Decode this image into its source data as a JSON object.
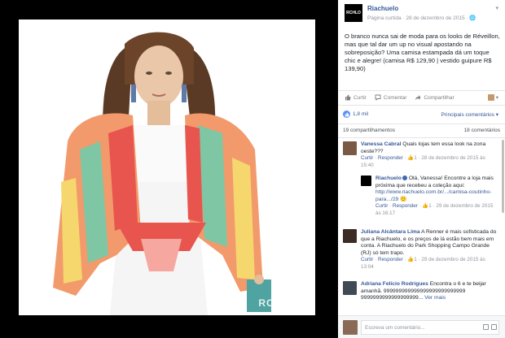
{
  "photo": {
    "watermark": "RCHLO"
  },
  "post": {
    "page_avatar_text": "RCHLO",
    "page_name": "Riachuelo",
    "meta": "Página curtida · 28 de dezembro de 2015 · ",
    "text": "O branco nunca sai de moda para os looks de Réveillon, mas que tal dar um up no visual apostando na sobreposição? Uma camisa estampada dá um toque chic e alegre! (camisa R$ 129,90 | vestido guipure R$ 139,90)"
  },
  "actions": {
    "like": "Curtir",
    "comment": "Comentar",
    "share": "Compartilhar"
  },
  "likes": {
    "count": "1,8 mil",
    "top_comments": "Principais comentários ▾"
  },
  "shares": {
    "shares": "19 compartilhamentos",
    "comments": "18 comentários"
  },
  "comments": [
    {
      "name": "Vanessa Cabral",
      "text": " Quais lojas tem essa look na zona oeste???",
      "meta_like": "Curtir",
      "meta_reply": "Responder",
      "meta_rest": " · 👍1 · 28 de dezembro de 2015 às 15:40"
    },
    {
      "name": "Riachuelo",
      "text": " Olá, Vanessa! Encontre a loja mais próxima que recebeu a coleção aqui: ",
      "link": "http://www.riachuelo.com.br/.../camisa-coutinho-para.../29",
      "link_suffix": " 🙂",
      "meta_like": "Curtir",
      "meta_reply": "Responder",
      "meta_rest": " · 👍1 · 29 de dezembro de 2015 às 16:17"
    },
    {
      "name": "Juliana Alcântara Lima",
      "text": " A Renner é mais sofisticada do que a Riachuelo, e os preços de lá estão bem mais em conta. A Riachuelo do Park Shopping Campo Grande (RJ) só tem trapo.",
      "meta_like": "Curtir",
      "meta_reply": "Responder",
      "meta_rest": " · 👍1 · 29 de dezembro de 2015 às 13:04"
    },
    {
      "name": "Adriana Felício Rodrigues",
      "text": " Encontra o 6 e te beijar amanhã. 999999999999999999999999999 9999999999999999999... ",
      "more": "Ver mais"
    }
  ],
  "write": {
    "placeholder": "Escreva um comentário..."
  }
}
